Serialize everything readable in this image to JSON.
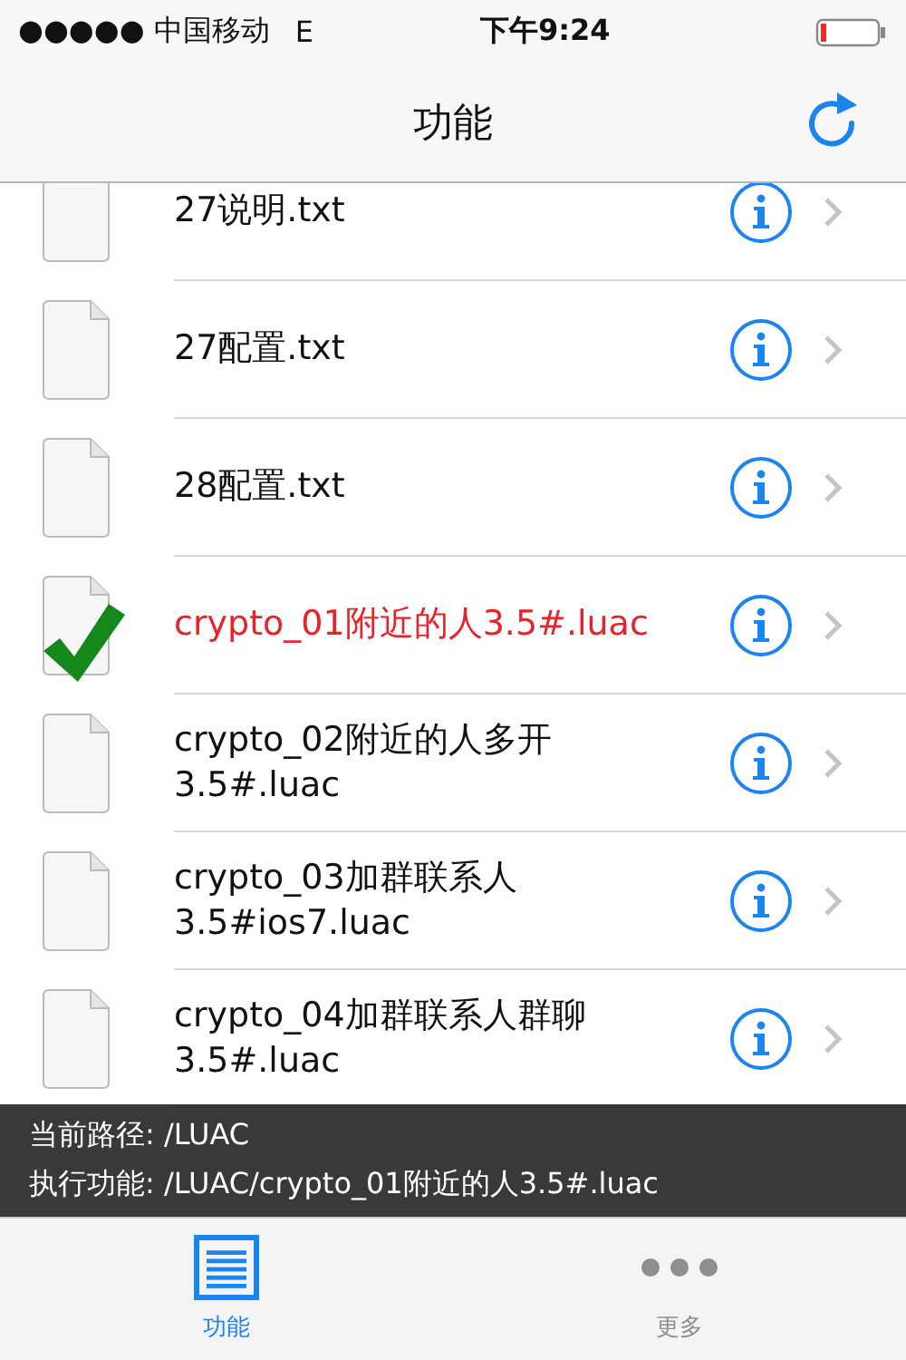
{
  "status_bar": {
    "carrier": "●●●●● 中国移动",
    "network": "E",
    "time": "下午9:24"
  },
  "nav": {
    "title": "功能"
  },
  "files": [
    {
      "name": "27说明.txt",
      "selected": false
    },
    {
      "name": "27配置.txt",
      "selected": false
    },
    {
      "name": "28配置.txt",
      "selected": false
    },
    {
      "name": "crypto_01附近的人3.5#.luac",
      "selected": true
    },
    {
      "name": "crypto_02附近的人多开3.5#.luac",
      "selected": false
    },
    {
      "name": "crypto_03加群联系人3.5#ios7.luac",
      "selected": false
    },
    {
      "name": "crypto_04加群联系人群聊3.5#.luac",
      "selected": false
    }
  ],
  "info_overlay": {
    "lines": [
      "当前路径: /LUAC",
      "执行功能: /LUAC/crypto_01附近的人3.5#.luac"
    ]
  },
  "tabs": [
    {
      "label": "功能",
      "kind": "list",
      "selected": true
    },
    {
      "label": "更多",
      "kind": "more",
      "selected": false
    }
  ]
}
